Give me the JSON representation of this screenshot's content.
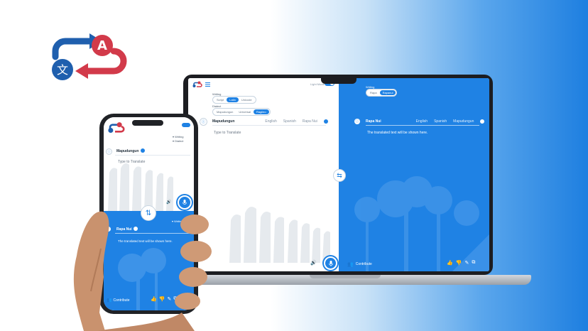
{
  "laptop": {
    "header": {
      "menu_icon": "hamburger-icon",
      "toggle_label": "Light Mode"
    },
    "left": {
      "writing_label": "Writing",
      "writing_options": [
        "Script",
        "Latin",
        "Unicode"
      ],
      "writing_selected_index": 1,
      "dialect_label": "Dialect",
      "dialect_options": [
        "Mapudungun",
        "Universal",
        "Ragileo"
      ],
      "dialect_selected_index": 2,
      "tabs": [
        "Mapudungun",
        "English",
        "Spanish",
        "Rapa Nui"
      ],
      "selected_tab_index": 0,
      "placeholder": "Type to Translate"
    },
    "right": {
      "writing_label": "Writing",
      "writing_options": [
        "Rapa",
        "Rapanui"
      ],
      "writing_selected_index": 1,
      "tabs": [
        "Rapa Nui",
        "English",
        "Spanish",
        "Mapudungun"
      ],
      "selected_tab_index": 0,
      "result_text": "The translated text will be shown here.",
      "contribute_label": "Contribute"
    }
  },
  "phone": {
    "top": {
      "writing_label": "Writing",
      "dialect_label": "Dialect",
      "source_language": "Mapudungun",
      "placeholder": "Type to Translate"
    },
    "bottom": {
      "writing_label": "Writing",
      "target_language": "Rapa Nui",
      "result_text": "The translated text will be shown here.",
      "contribute_label": "Contribute"
    }
  },
  "colors": {
    "accent": "#1f82e4",
    "logo_blue": "#1f5fae",
    "logo_red": "#d23a4a"
  }
}
